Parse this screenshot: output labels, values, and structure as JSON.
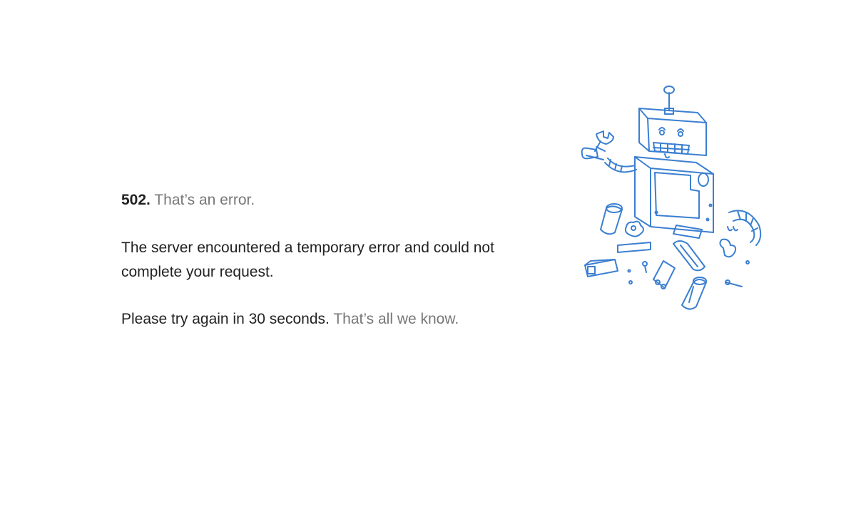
{
  "error": {
    "code": "502.",
    "headline": "That’s an error.",
    "message": "The server encountered a temporary error and could not complete your request.",
    "retry": "Please try again in 30 seconds.",
    "footnote": "That’s all we know."
  },
  "illustration": {
    "icon": "broken-robot-icon",
    "stroke_color": "#3b7fd1"
  }
}
